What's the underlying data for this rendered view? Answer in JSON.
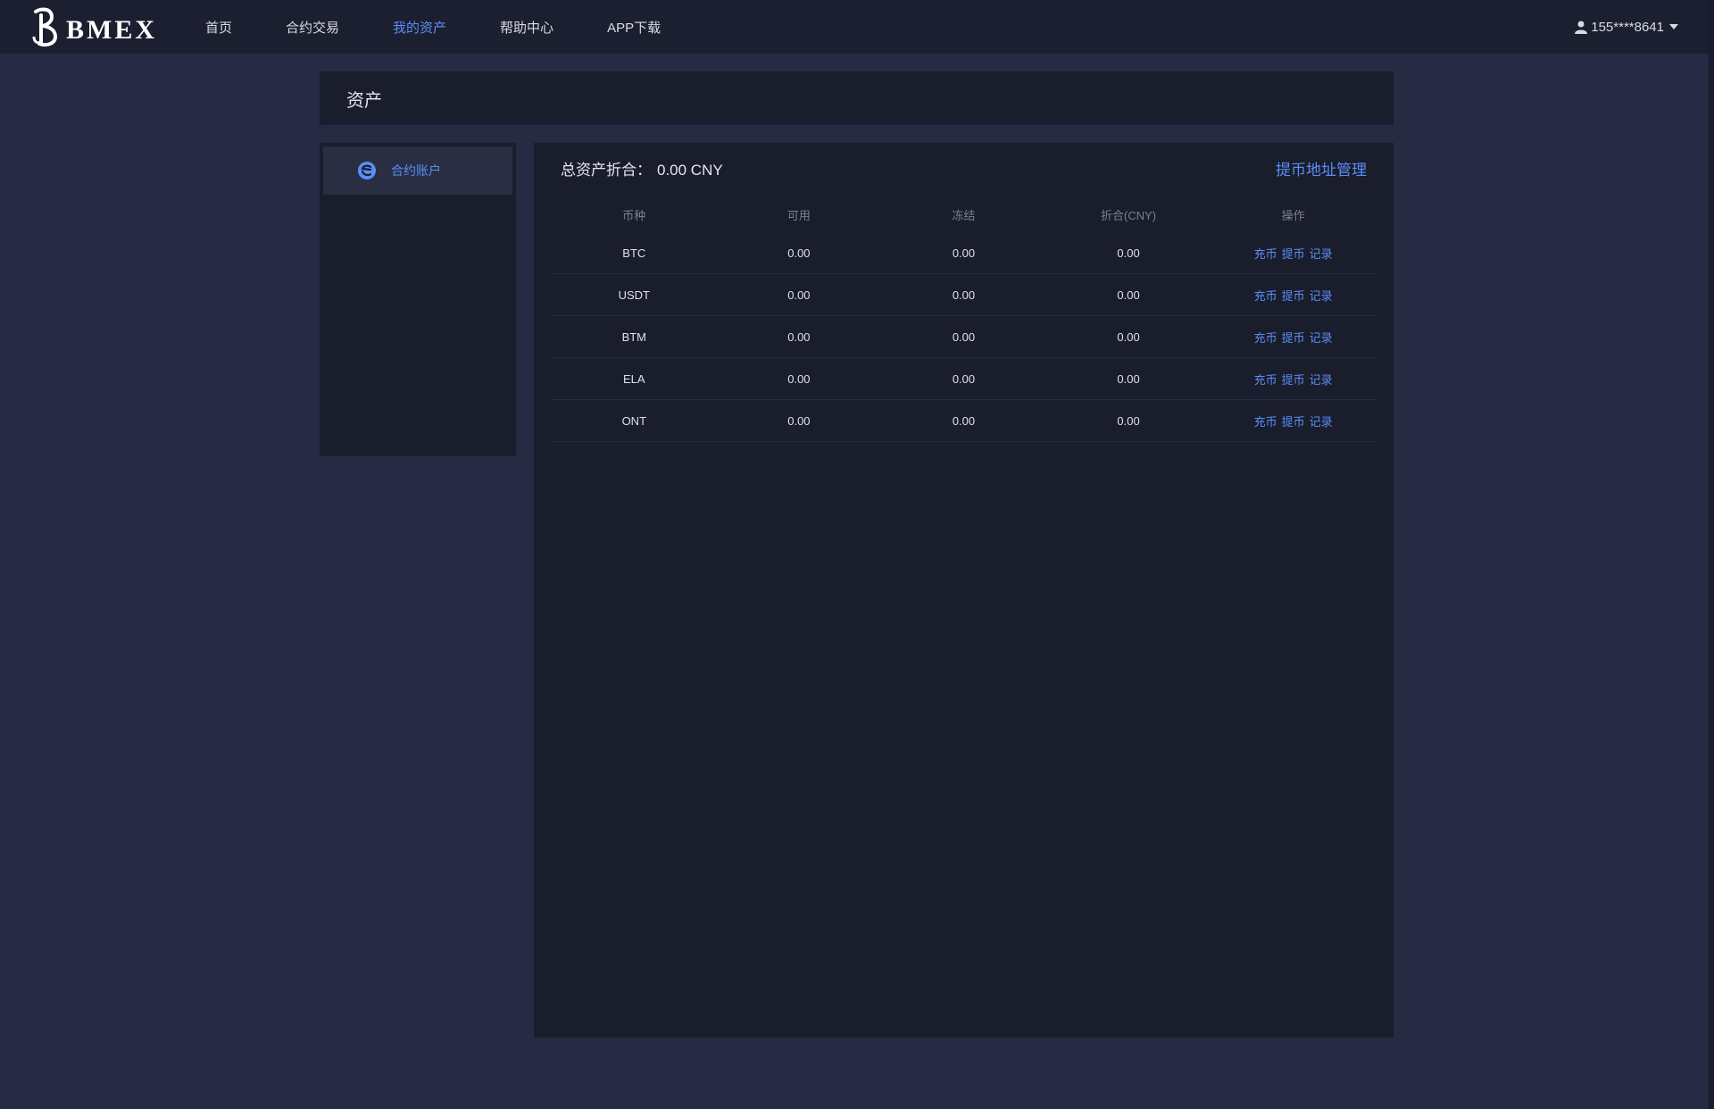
{
  "header": {
    "logo_text": "BMEX",
    "nav": [
      {
        "label": "首页"
      },
      {
        "label": "合约交易"
      },
      {
        "label": "我的资产"
      },
      {
        "label": "帮助中心"
      },
      {
        "label": "APP下载"
      }
    ],
    "active_nav": "我的资产",
    "user_label": "155****8641"
  },
  "page": {
    "title": "资产"
  },
  "sidebar": {
    "items": [
      {
        "label": "合约账户",
        "icon": "contract-account-icon"
      }
    ]
  },
  "assets": {
    "total_label": "总资产折合：",
    "total_value": "0.00 CNY",
    "address_link": "提币地址管理",
    "columns": [
      "币种",
      "可用",
      "冻结",
      "折合(CNY)",
      "操作"
    ],
    "rows": [
      {
        "coin": "BTC",
        "available": "0.00",
        "frozen": "0.00",
        "cny": "0.00"
      },
      {
        "coin": "USDT",
        "available": "0.00",
        "frozen": "0.00",
        "cny": "0.00"
      },
      {
        "coin": "BTM",
        "available": "0.00",
        "frozen": "0.00",
        "cny": "0.00"
      },
      {
        "coin": "ELA",
        "available": "0.00",
        "frozen": "0.00",
        "cny": "0.00"
      },
      {
        "coin": "ONT",
        "available": "0.00",
        "frozen": "0.00",
        "cny": "0.00"
      }
    ],
    "actions": [
      "充币",
      "提币",
      "记录"
    ]
  },
  "colors": {
    "accent": "#5b8ef5",
    "background": "#262a43",
    "panel": "#1a1d2c",
    "topbar": "#1c1f30"
  }
}
